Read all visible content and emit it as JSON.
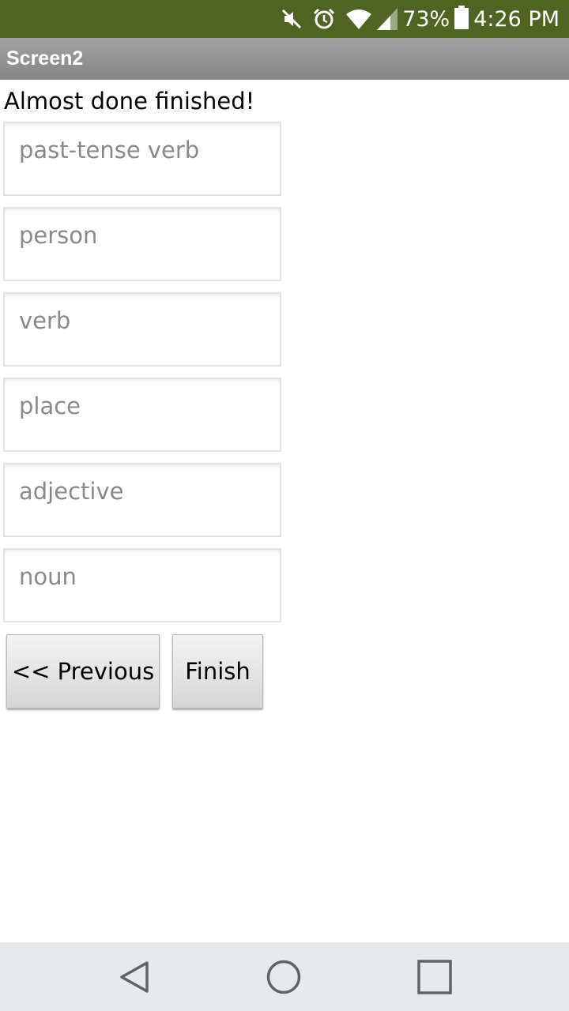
{
  "status_bar": {
    "battery_percent": "73%",
    "time": "4:26 PM",
    "icons": [
      "mute-icon",
      "alarm-icon",
      "wifi-icon",
      "signal-icon",
      "battery-icon"
    ]
  },
  "title_bar": {
    "title": "Screen2"
  },
  "main": {
    "headline": "Almost done finished!",
    "fields": [
      {
        "placeholder": "past-tense verb",
        "value": ""
      },
      {
        "placeholder": "person",
        "value": ""
      },
      {
        "placeholder": "verb",
        "value": ""
      },
      {
        "placeholder": "place",
        "value": ""
      },
      {
        "placeholder": "adjective",
        "value": ""
      },
      {
        "placeholder": "noun",
        "value": ""
      }
    ],
    "buttons": {
      "previous": "<< Previous",
      "finish": "Finish"
    }
  },
  "nav_bar": {
    "icons": [
      "back-icon",
      "home-icon",
      "recents-icon"
    ]
  },
  "colors": {
    "status_bar": "#4f6423",
    "title_bar": "#959595",
    "nav_bar": "#e8e9ec"
  }
}
